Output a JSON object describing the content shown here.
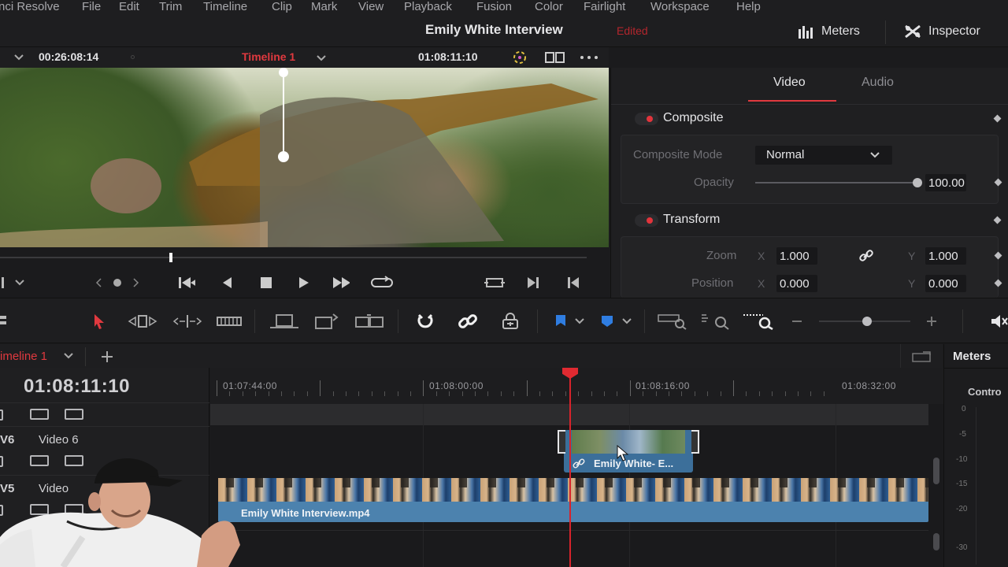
{
  "menu": [
    "nci Resolve",
    "File",
    "Edit",
    "Trim",
    "Timeline",
    "Clip",
    "Mark",
    "View",
    "Playback",
    "Fusion",
    "Color",
    "Fairlight",
    "Workspace",
    "Help"
  ],
  "title_bar": {
    "project_title": "Emily White Interview",
    "status": "Edited",
    "meters_label": "Meters",
    "inspector_label": "Inspector"
  },
  "viewer": {
    "source_timecode": "00:26:08:14",
    "timeline_name": "Timeline 1",
    "record_timecode": "01:08:11:10"
  },
  "inspector": {
    "tabs": [
      "Video",
      "Audio"
    ],
    "active_tab": "Video",
    "composite": {
      "header": "Composite",
      "mode_label": "Composite Mode",
      "mode_value": "Normal",
      "opacity_label": "Opacity",
      "opacity_value": "100.00",
      "opacity_fraction": 1.0
    },
    "transform": {
      "header": "Transform",
      "zoom_label": "Zoom",
      "zoom_x": "1.000",
      "zoom_y": "1.000",
      "position_label": "Position",
      "position_x": "0.000",
      "position_y": "0.000",
      "x_label": "X",
      "y_label": "Y"
    }
  },
  "timeline": {
    "tab_name": "imeline 1",
    "current_timecode": "01:08:11:10",
    "ruler_timecodes": [
      "01:07:44:00",
      "01:08:00:00",
      "01:08:16:00",
      "01:08:32:00"
    ],
    "tracks": [
      {
        "id": "V6",
        "name": "Video 6"
      },
      {
        "id": "V5",
        "name": "Video"
      }
    ],
    "clips": {
      "small_clip_label": "Emily White- E...",
      "main_clip_label": "Emily White Interview.mp4"
    }
  },
  "meters_panel": {
    "header": "Meters",
    "control_label": "Contro",
    "scale": [
      "0",
      "-5",
      "-10",
      "-15",
      "-20",
      "-30"
    ]
  },
  "colors": {
    "accent_red": "#e02a31",
    "clip_blue": "#4c82ae",
    "toolbar_blue": "#2f7de1"
  }
}
